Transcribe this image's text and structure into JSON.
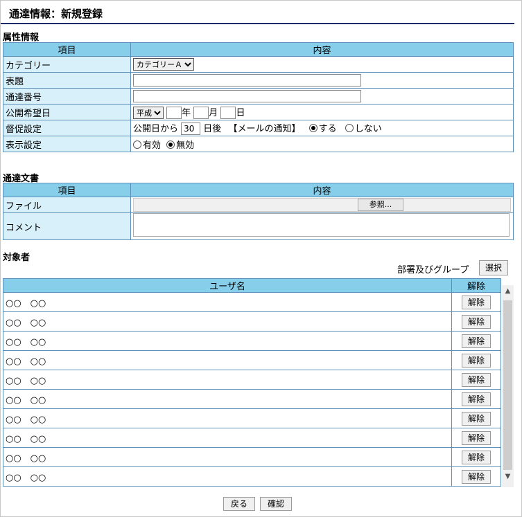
{
  "page": {
    "title": "通達情報：新規登録"
  },
  "attributes": {
    "heading": "属性情報",
    "col_item": "項目",
    "col_content": "内容",
    "category_label": "カテゴリー",
    "category_value": "カテゴリーＡ",
    "subject_label": "表題",
    "number_label": "通達番号",
    "date_label": "公開希望日",
    "era_value": "平成",
    "year_unit": "年",
    "month_unit": "月",
    "day_unit": "日",
    "reminder_label": "督促設定",
    "reminder_prefix": "公開日から",
    "reminder_days": "30",
    "reminder_suffix": "日後",
    "mail_notify": "【メールの通知】",
    "notify_yes": "する",
    "notify_no": "しない",
    "display_label": "表示設定",
    "display_valid": "有効",
    "display_invalid": "無効"
  },
  "document": {
    "heading": "通達文書",
    "col_item": "項目",
    "col_content": "内容",
    "file_label": "ファイル",
    "browse_button": "参照...",
    "comment_label": "コメント"
  },
  "targets": {
    "heading": "対象者",
    "group_label": "部署及びグループ",
    "select_button": "選択",
    "col_user": "ユーザ名",
    "col_remove": "解除",
    "rows": [
      {
        "name": "○○　○○",
        "action": "解除"
      },
      {
        "name": "○○　○○",
        "action": "解除"
      },
      {
        "name": "○○　○○",
        "action": "解除"
      },
      {
        "name": "○○　○○",
        "action": "解除"
      },
      {
        "name": "○○　○○",
        "action": "解除"
      },
      {
        "name": "○○　○○",
        "action": "解除"
      },
      {
        "name": "○○　○○",
        "action": "解除"
      },
      {
        "name": "○○　○○",
        "action": "解除"
      },
      {
        "name": "○○　○○",
        "action": "解除"
      },
      {
        "name": "○○　○○",
        "action": "解除"
      }
    ]
  },
  "footer": {
    "back_button": "戻る",
    "confirm_button": "確認"
  },
  "colors": {
    "header_bg": "#87ceeb",
    "label_bg": "#d7f0fa",
    "border": "#5b8fb8",
    "title_rule": "#1c2a6b"
  }
}
